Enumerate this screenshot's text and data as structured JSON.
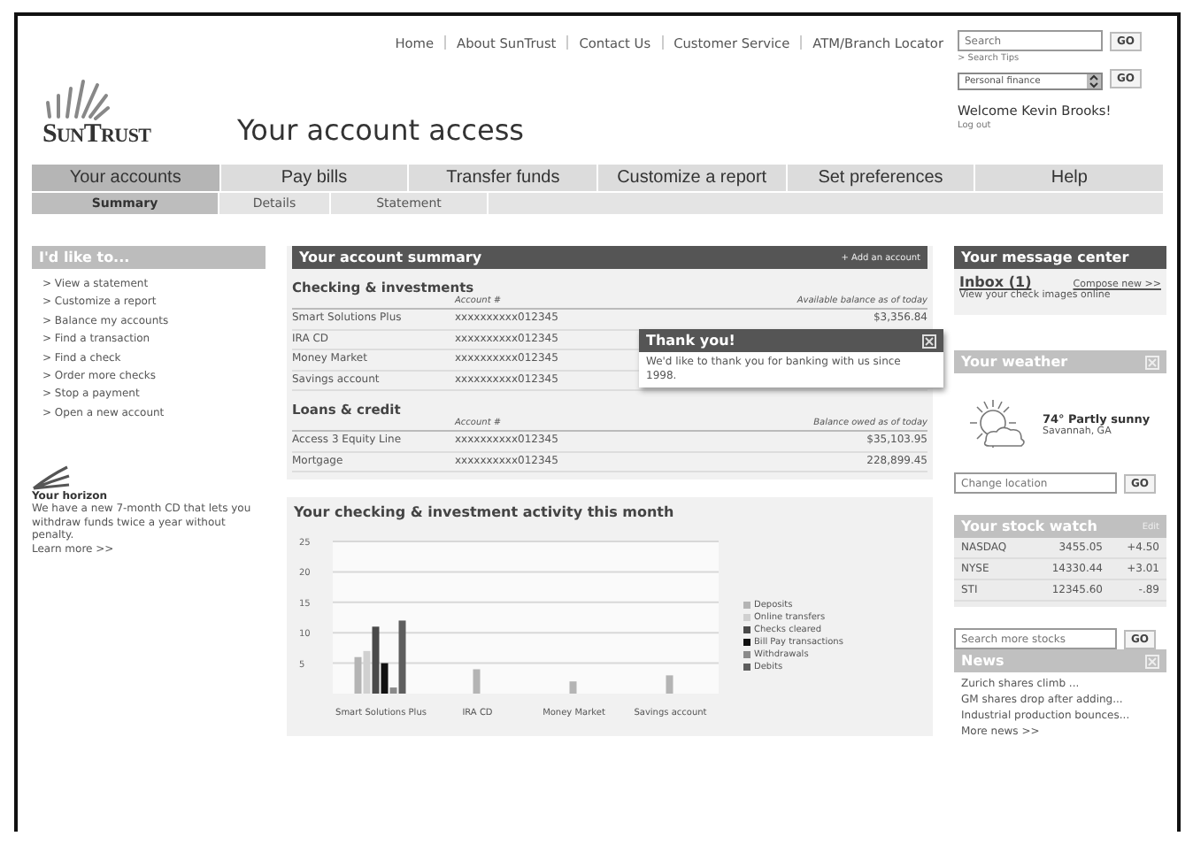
{
  "header": {
    "brand": "SunTrust",
    "title": "Your account access",
    "nav": [
      "Home",
      "About SunTrust",
      "Contact Us",
      "Customer Service",
      "ATM/Branch Locator"
    ],
    "search": {
      "placeholder": "Search",
      "button": "GO",
      "tips": "> Search Tips"
    },
    "select": {
      "value": "Personal finance",
      "button": "GO"
    },
    "welcome": "Welcome Kevin Brooks!",
    "logout": "Log out"
  },
  "tabs": [
    {
      "label": "Your accounts",
      "selected": true
    },
    {
      "label": "Pay bills",
      "selected": false
    },
    {
      "label": "Transfer funds",
      "selected": false
    },
    {
      "label": "Customize a report",
      "selected": false
    },
    {
      "label": "Set preferences",
      "selected": false
    },
    {
      "label": "Help",
      "selected": false
    }
  ],
  "subtabs": [
    {
      "label": "Summary",
      "selected": true
    },
    {
      "label": "Details",
      "selected": false
    },
    {
      "label": "Statement",
      "selected": false
    }
  ],
  "sidebar": {
    "title": "I'd like to...",
    "items": [
      "> View a statement",
      "> Customize a report",
      "> Balance my accounts",
      "> Find a transaction",
      "> Find a check",
      "> Order more checks",
      "> Stop a payment",
      "> Open a new account"
    ],
    "promo": {
      "title": "Your horizon",
      "text": "We have a new 7-month CD that lets you withdraw funds twice a year without penalty.",
      "link": "Learn more >>"
    }
  },
  "summary": {
    "title": "Your account summary",
    "action": "+ Add an account",
    "sections": [
      {
        "title": "Checking & investments",
        "columns": [
          "Account #",
          "Available balance as of today"
        ],
        "rows": [
          {
            "name": "Smart Solutions Plus",
            "account": "xxxxxxxxxx012345",
            "balance": "$3,356.84"
          },
          {
            "name": "IRA CD",
            "account": "xxxxxxxxxx012345"
          },
          {
            "name": "Money Market",
            "account": "xxxxxxxxxx012345"
          },
          {
            "name": "Savings account",
            "account": "xxxxxxxxxx012345"
          }
        ]
      },
      {
        "title": "Loans & credit",
        "columns": [
          "Account #",
          "Balance owed as of today"
        ],
        "rows": [
          {
            "name": "Access 3 Equity Line",
            "account": "xxxxxxxxxx012345",
            "balance": "$35,103.95"
          },
          {
            "name": "Mortgage",
            "account": "xxxxxxxxxx012345",
            "balance": "228,899.45"
          }
        ]
      }
    ],
    "popup": {
      "title": "Thank you!",
      "text": "We'd like to thank you for banking with us since 1998."
    }
  },
  "activity": {
    "title": "Your checking & investment activity this month",
    "chart_data": {
      "type": "bar",
      "grid": true,
      "legend": true,
      "categories": [
        "Smart Solutions Plus",
        "IRA CD",
        "Money Market",
        "Savings account"
      ],
      "ylim": [
        0,
        25
      ],
      "yticks": [
        5,
        10,
        15,
        20,
        25
      ],
      "series": [
        {
          "name": "Deposits",
          "color": "#b4b4b4",
          "values": [
            6,
            4,
            2,
            3
          ]
        },
        {
          "name": "Online transfers",
          "color": "#d0d0d0",
          "values": [
            7,
            null,
            null,
            null
          ]
        },
        {
          "name": "Checks cleared",
          "color": "#4a4a4a",
          "values": [
            11,
            null,
            null,
            null
          ]
        },
        {
          "name": "Bill Pay transactions",
          "color": "#111111",
          "values": [
            5,
            null,
            null,
            null
          ]
        },
        {
          "name": "Withdrawals",
          "color": "#8a8a8a",
          "values": [
            1,
            null,
            null,
            null
          ]
        },
        {
          "name": "Debits",
          "color": "#5e5e5e",
          "values": [
            12,
            null,
            null,
            null
          ]
        }
      ]
    }
  },
  "messages": {
    "title": "Your message center",
    "inbox": "Inbox (1)",
    "compose": "Compose new >>",
    "text": "View your check images online"
  },
  "weather": {
    "title": "Your weather",
    "condition": "74° Partly sunny",
    "place": "Savannah, GA",
    "placeholder": "Change location",
    "button": "GO"
  },
  "stocks": {
    "title": "Your stock watch",
    "edit": "Edit",
    "rows": [
      {
        "name": "NASDAQ",
        "value": "3455.05",
        "change": "+4.50"
      },
      {
        "name": "NYSE",
        "value": "14330.44",
        "change": "+3.01"
      },
      {
        "name": "STI",
        "value": "12345.60",
        "change": "-.89"
      }
    ],
    "placeholder": "Search more stocks",
    "button": "GO"
  },
  "news": {
    "title": "News",
    "items": [
      "Zurich shares climb ...",
      "GM shares drop after adding...",
      "Industrial production bounces..."
    ],
    "more": "More news >>"
  }
}
